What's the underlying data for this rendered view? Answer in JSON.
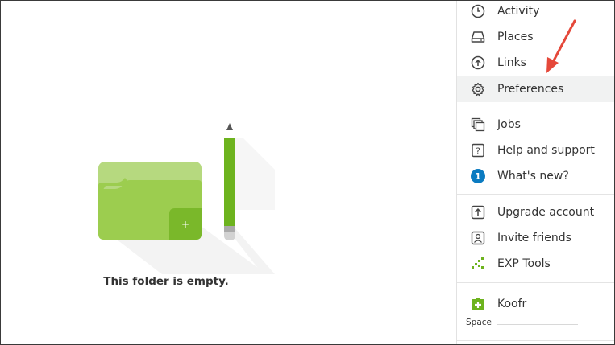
{
  "menu": {
    "items": [
      {
        "label": "Activity",
        "icon": "clock-icon"
      },
      {
        "label": "Places",
        "icon": "drive-icon"
      },
      {
        "label": "Links",
        "icon": "cloud-upload-icon"
      },
      {
        "label": "Preferences",
        "icon": "gear-icon"
      },
      {
        "label": "Jobs",
        "icon": "stacked-squares-icon"
      },
      {
        "label": "Help and support",
        "icon": "question-icon"
      },
      {
        "label": "What's new?",
        "icon": "badge-icon",
        "badge": "1"
      },
      {
        "label": "Upgrade account",
        "icon": "upgrade-arrow-icon"
      },
      {
        "label": "Invite friends",
        "icon": "person-card-icon"
      },
      {
        "label": "EXP Tools",
        "icon": "exp-tools-icon"
      },
      {
        "label": "Koofr",
        "icon": "koofr-logo-icon"
      }
    ],
    "space_label": "Space"
  },
  "main": {
    "empty_message": "This folder is empty."
  },
  "colors": {
    "folder_light": "#b6d97f",
    "folder_main": "#9ccd4f",
    "folder_dark": "#7ab82a",
    "accent_green": "#6db31e",
    "badge_blue": "#0b7bc1",
    "arrow_red": "#e5483a",
    "highlight": "#f1f2f2"
  }
}
